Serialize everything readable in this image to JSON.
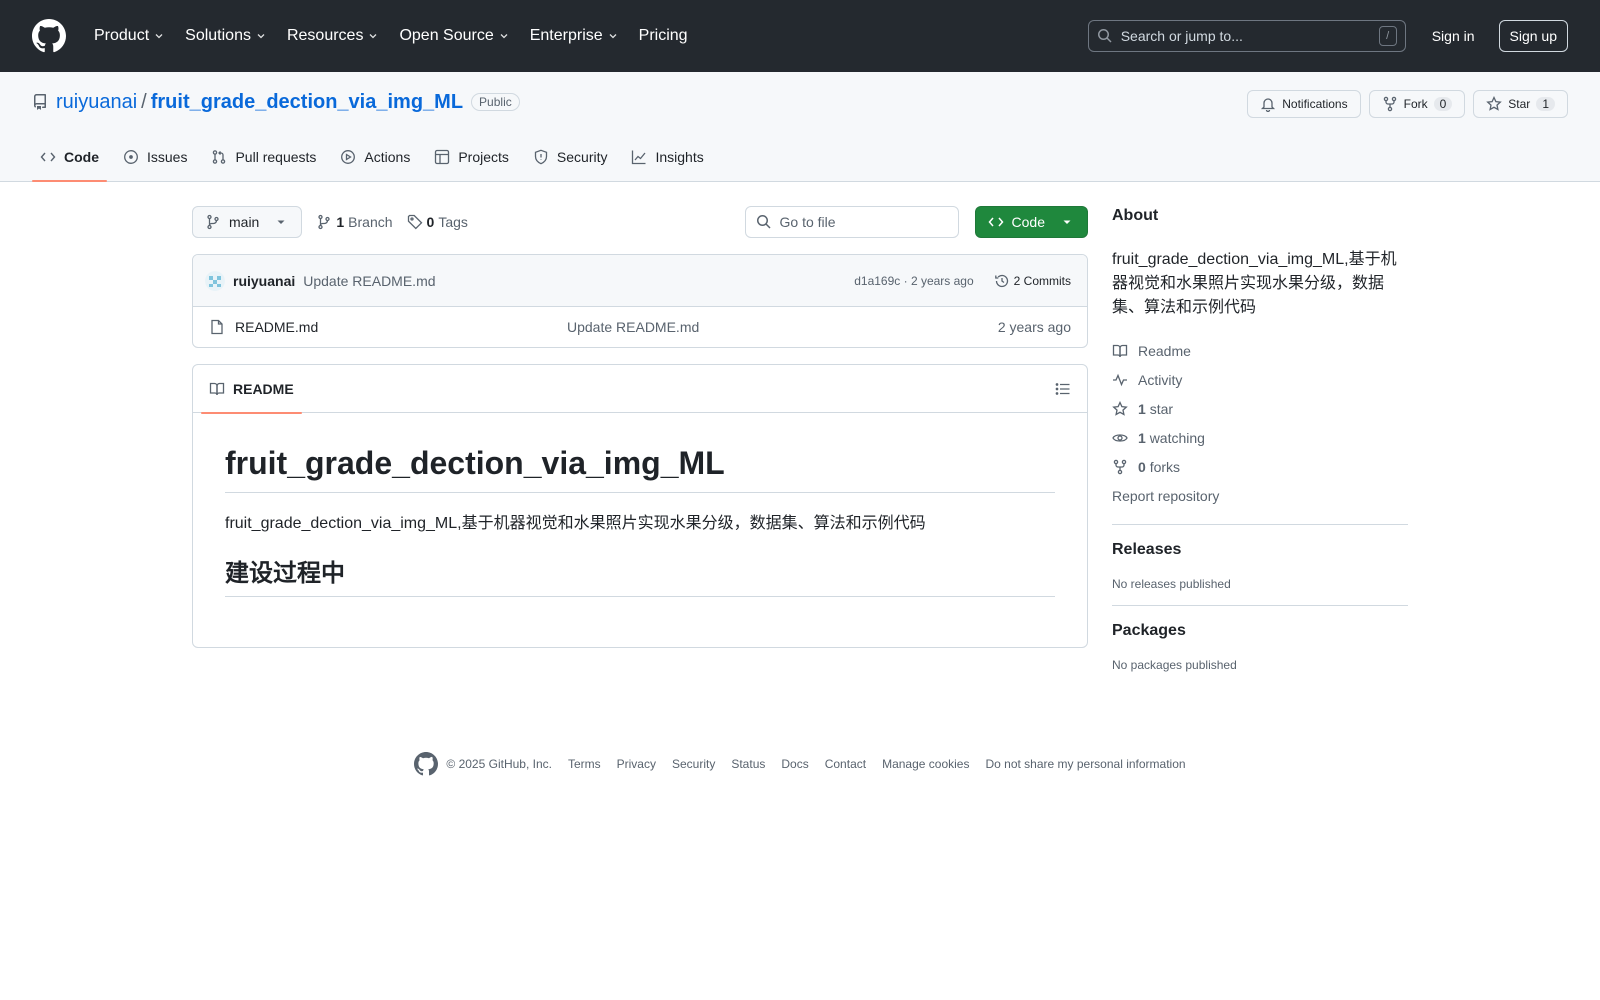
{
  "header": {
    "nav": [
      "Product",
      "Solutions",
      "Resources",
      "Open Source",
      "Enterprise",
      "Pricing"
    ],
    "search_placeholder": "Search or jump to...",
    "search_shortcut": "/",
    "sign_in": "Sign in",
    "sign_up": "Sign up"
  },
  "repo": {
    "owner": "ruiyuanai",
    "separator": "/",
    "name": "fruit_grade_dection_via_img_ML",
    "visibility": "Public",
    "notifications_label": "Notifications",
    "fork_label": "Fork",
    "fork_count": "0",
    "star_label": "Star",
    "star_count": "1"
  },
  "tabs": [
    "Code",
    "Issues",
    "Pull requests",
    "Actions",
    "Projects",
    "Security",
    "Insights"
  ],
  "file_nav": {
    "branch": "main",
    "branch_count": "1",
    "branch_label": "Branch",
    "tag_count": "0",
    "tag_label": "Tags",
    "goto_placeholder": "Go to file",
    "code_button": "Code"
  },
  "commit": {
    "author": "ruiyuanai",
    "message": "Update README.md",
    "sha_time": "d1a169c · 2 years ago",
    "commits_label": "2 Commits"
  },
  "files": [
    {
      "name": "README.md",
      "commit": "Update README.md",
      "age": "2 years ago"
    }
  ],
  "readme": {
    "tab": "README",
    "h1": "fruit_grade_dection_via_img_ML",
    "p": "fruit_grade_dection_via_img_ML,基于机器视觉和水果照片实现水果分级，数据集、算法和示例代码",
    "h2": "建设过程中"
  },
  "about": {
    "title": "About",
    "desc": "fruit_grade_dection_via_img_ML,基于机器视觉和水果照片实现水果分级，数据集、算法和示例代码",
    "readme": "Readme",
    "activity": "Activity",
    "stars_count": "1",
    "stars_label": "star",
    "watching_count": "1",
    "watching_label": "watching",
    "forks_count": "0",
    "forks_label": "forks",
    "report": "Report repository"
  },
  "releases": {
    "title": "Releases",
    "note": "No releases published"
  },
  "packages": {
    "title": "Packages",
    "note": "No packages published"
  },
  "footer": {
    "copyright": "© 2025 GitHub, Inc.",
    "links": [
      "Terms",
      "Privacy",
      "Security",
      "Status",
      "Docs",
      "Contact",
      "Manage cookies",
      "Do not share my personal information"
    ]
  },
  "colors": {
    "header_bg": "#24292f",
    "link": "#0969da",
    "primary_button": "#1f883d",
    "tab_underline": "#fd8c73"
  }
}
